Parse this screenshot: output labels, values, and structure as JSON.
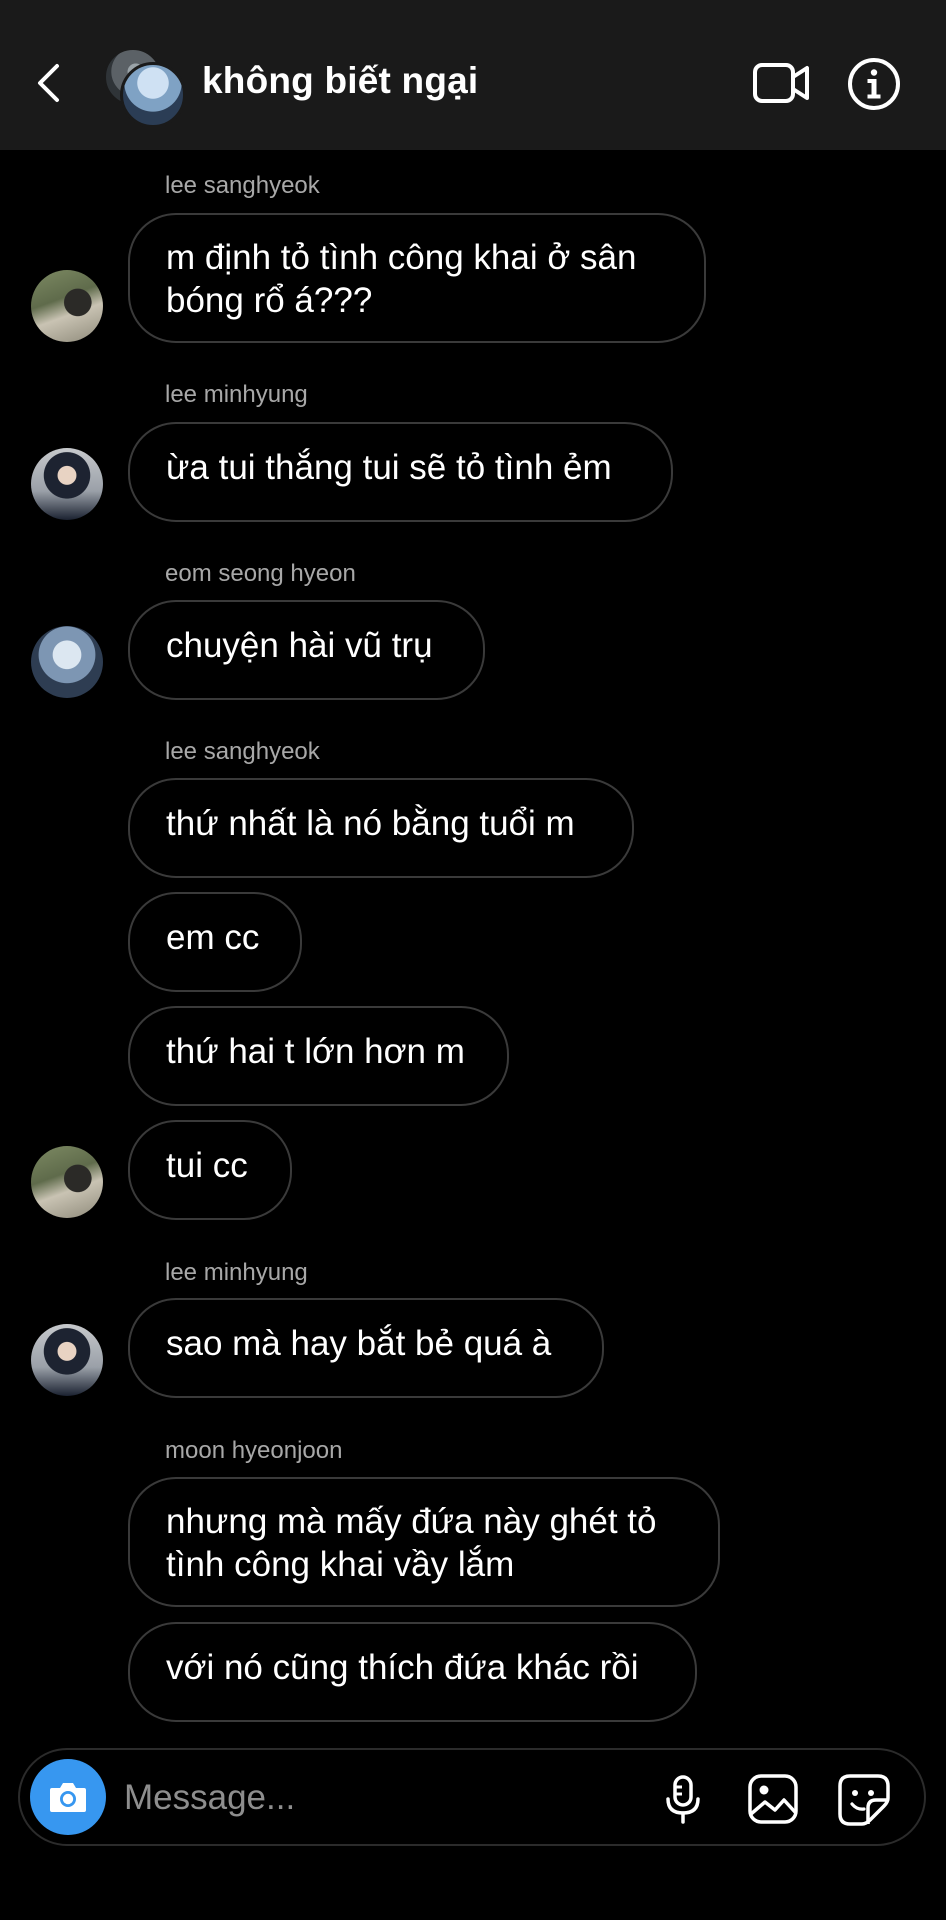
{
  "header": {
    "title": "không biết ngại",
    "back_icon": "chevron-left-icon",
    "video_icon": "video-camera-icon",
    "info_icon": "info-icon"
  },
  "messages": [
    {
      "sender": "lee sanghyeok",
      "text_lines": [
        "m định tỏ tình công khai ở sân",
        "bóng rổ á???"
      ]
    },
    {
      "sender": "lee minhyung",
      "text": "ừa tui thắng tui sẽ tỏ tình ẻm"
    },
    {
      "sender": "eom seong hyeon",
      "text": "chuyện hài vũ trụ"
    },
    {
      "sender": "lee sanghyeok",
      "texts": [
        "thứ nhất là nó bằng tuổi m",
        "em cc",
        "thứ hai t lớn hơn m",
        "tui cc"
      ]
    },
    {
      "sender": "lee minhyung",
      "text": "sao mà hay bắt bẻ quá à"
    },
    {
      "sender": "moon hyeonjoon",
      "text_lines": [
        "nhưng mà mấy đứa này ghét tỏ",
        "tình công khai vầy lắm"
      ],
      "text2": "với nó cũng thích đứa khác rồi"
    }
  ],
  "composer": {
    "placeholder": "Message...",
    "camera_icon": "camera-icon",
    "mic_icon": "microphone-icon",
    "gallery_icon": "gallery-icon",
    "sticker_icon": "sticker-icon"
  },
  "colors": {
    "header_bg": "#1a1a1a",
    "bubble_border": "#3a3a3a",
    "camera_button": "#3797f0",
    "sender_text": "#a8a8a8"
  }
}
